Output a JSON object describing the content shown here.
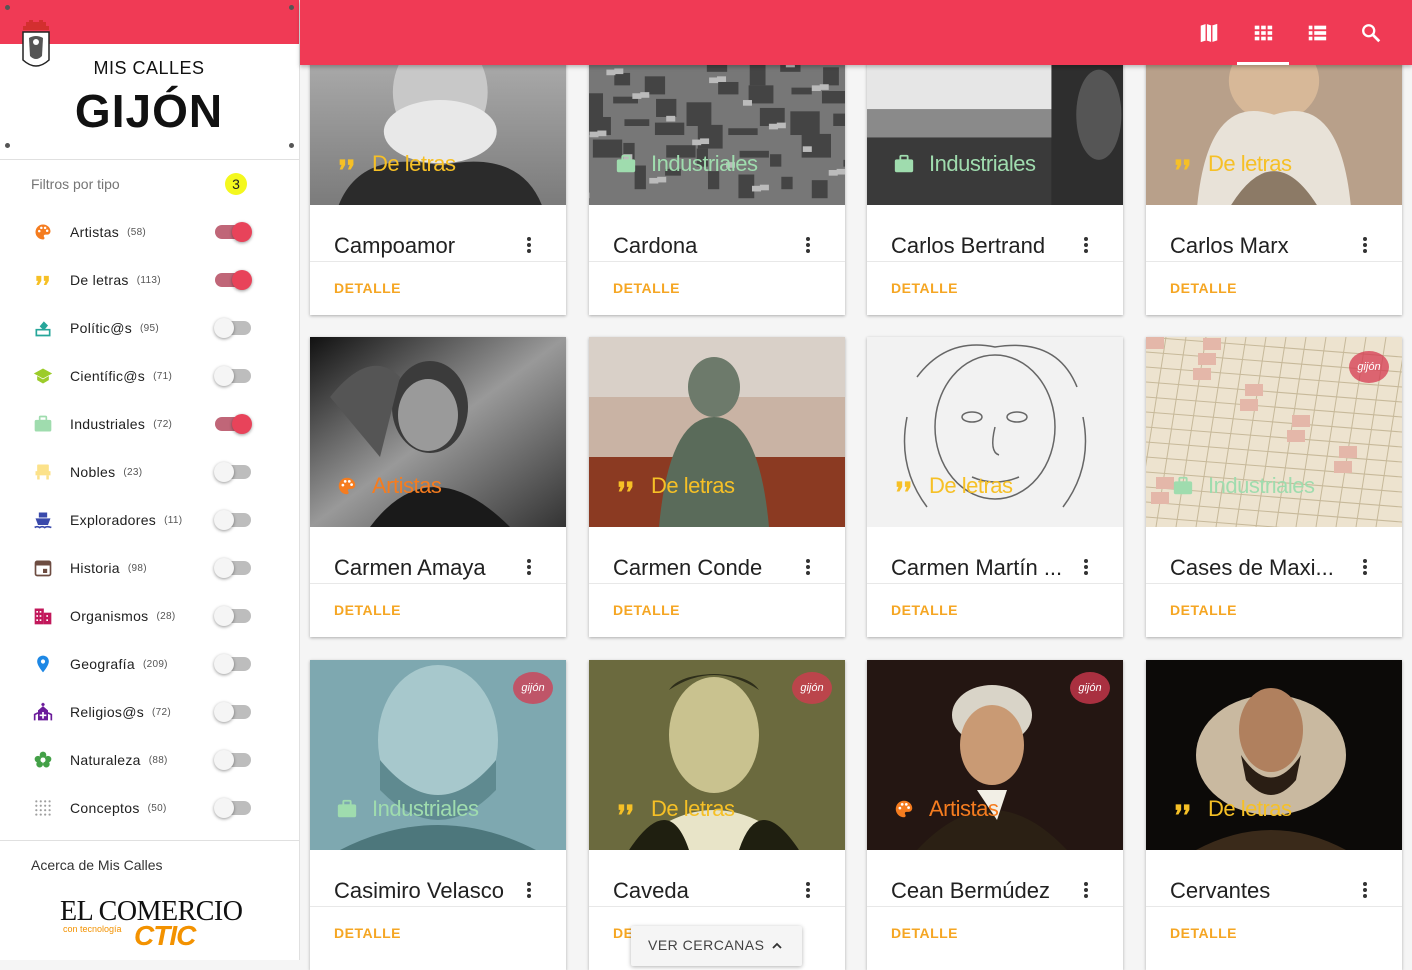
{
  "app": {
    "title_small": "MIS CALLES",
    "title_big": "GIJÓN",
    "brand_color": "#f03a55"
  },
  "filters": {
    "title": "Filtros por tipo",
    "active_count": "3",
    "items": [
      {
        "label": "Artistas",
        "count": "(58)",
        "icon": "palette-icon",
        "color": "#f57c1f",
        "on": true
      },
      {
        "label": "De letras",
        "count": "(113)",
        "icon": "quote-icon",
        "color": "#f6c026",
        "on": true
      },
      {
        "label": "Polític@s",
        "count": "(95)",
        "icon": "ballot-icon",
        "color": "#26a69a",
        "on": false
      },
      {
        "label": "Científic@s",
        "count": "(71)",
        "icon": "school-icon",
        "color": "#9ccc2a",
        "on": false
      },
      {
        "label": "Industriales",
        "count": "(72)",
        "icon": "briefcase-icon",
        "color": "#9fdcae",
        "on": true
      },
      {
        "label": "Nobles",
        "count": "(23)",
        "icon": "throne-icon",
        "color": "#fce28a",
        "on": false
      },
      {
        "label": "Exploradores",
        "count": "(11)",
        "icon": "ship-icon",
        "color": "#3949ab",
        "on": false
      },
      {
        "label": "Historia",
        "count": "(98)",
        "icon": "calendar-icon",
        "color": "#6d4c41",
        "on": false
      },
      {
        "label": "Organismos",
        "count": "(28)",
        "icon": "building-icon",
        "color": "#c2185b",
        "on": false
      },
      {
        "label": "Geografía",
        "count": "(209)",
        "icon": "pin-icon",
        "color": "#1e88e5",
        "on": false
      },
      {
        "label": "Religios@s",
        "count": "(72)",
        "icon": "church-icon",
        "color": "#6a1b9a",
        "on": false
      },
      {
        "label": "Naturaleza",
        "count": "(88)",
        "icon": "flower-icon",
        "color": "#43a047",
        "on": false
      },
      {
        "label": "Conceptos",
        "count": "(50)",
        "icon": "grid-dots-icon",
        "color": "#9e9e9e",
        "on": false
      }
    ]
  },
  "about": {
    "label": "Acerca de Mis Calles",
    "logo_main": "EL COMERCIO",
    "logo_tech": "con tecnología",
    "logo_ctic": "CTIC"
  },
  "toolbar": {
    "icons": [
      "map-icon",
      "grid-view-icon",
      "list-view-icon",
      "search-icon"
    ]
  },
  "cards": [
    {
      "name": "Campoamor",
      "category": "De letras",
      "cat_icon": "quote-icon",
      "cat_color": "#f6c026",
      "detail": "DETALLE",
      "img": "bw-portrait"
    },
    {
      "name": "Cardona",
      "category": "Industriales",
      "cat_icon": "briefcase-icon",
      "cat_color": "#9fdcae",
      "detail": "DETALLE",
      "img": "bw-city"
    },
    {
      "name": "Carlos Bertrand",
      "category": "Industriales",
      "cat_icon": "briefcase-icon",
      "cat_color": "#9fdcae",
      "detail": "DETALLE",
      "img": "bw-coast"
    },
    {
      "name": "Carlos Marx",
      "category": "De letras",
      "cat_icon": "quote-icon",
      "cat_color": "#f6c026",
      "detail": "DETALLE",
      "img": "sepia-portrait"
    },
    {
      "name": "Carmen Amaya",
      "category": "Artistas",
      "cat_icon": "palette-icon",
      "cat_color": "#f57c1f",
      "detail": "DETALLE",
      "img": "bw-dancer"
    },
    {
      "name": "Carmen Conde",
      "category": "De letras",
      "cat_icon": "quote-icon",
      "cat_color": "#f6c026",
      "detail": "DETALLE",
      "img": "bronze-statue"
    },
    {
      "name": "Carmen Martín ...",
      "category": "De letras",
      "cat_icon": "quote-icon",
      "cat_color": "#f6c026",
      "detail": "DETALLE",
      "img": "sketch"
    },
    {
      "name": "Cases de Maxi...",
      "category": "Industriales",
      "cat_icon": "briefcase-icon",
      "cat_color": "#9fdcae",
      "detail": "DETALLE",
      "img": "old-map"
    },
    {
      "name": "Casimiro Velasco",
      "category": "Industriales",
      "cat_icon": "briefcase-icon",
      "cat_color": "#9fdcae",
      "detail": "DETALLE",
      "img": "teal-portrait"
    },
    {
      "name": "Caveda",
      "category": "De letras",
      "cat_icon": "quote-icon",
      "cat_color": "#f6c026",
      "detail": "DETALLE",
      "img": "olive-portrait"
    },
    {
      "name": "Cean Bermúdez",
      "category": "Artistas",
      "cat_icon": "palette-icon",
      "cat_color": "#f57c1f",
      "detail": "DETALLE",
      "img": "oil-portrait"
    },
    {
      "name": "Cervantes",
      "category": "De letras",
      "cat_icon": "quote-icon",
      "cat_color": "#f6c026",
      "detail": "DETALLE",
      "img": "dark-portrait"
    }
  ],
  "gijon_badge": "gijón",
  "nearby": {
    "label": "VER CERCANAS"
  }
}
